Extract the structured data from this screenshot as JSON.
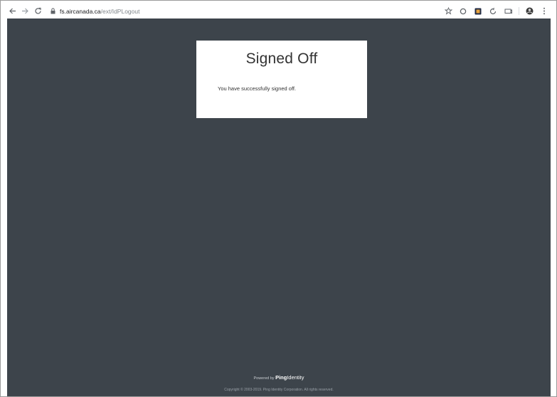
{
  "browser": {
    "url_host": "fs.aircanada.ca",
    "url_path": "/ext/IdPLogout"
  },
  "page": {
    "title": "Signed Off",
    "message": "You have successfully signed off.",
    "powered_by": "Powered by",
    "brand_ping": "Ping",
    "brand_identity": "Identity",
    "copyright": "Copyright © 2003-2019. Ping Identity Corporation. All rights reserved."
  },
  "colors": {
    "page_background": "#3d444b",
    "card_background": "#ffffff",
    "text": "#333333"
  },
  "icons": {
    "back": "arrow-left-icon",
    "forward": "arrow-right-icon",
    "reload": "reload-icon",
    "lock": "lock-icon",
    "bookmark": "star-icon",
    "extensions": [
      "circle-extension-icon",
      "square-extension-icon",
      "sync-extension-icon",
      "cast-extension-icon"
    ],
    "profile": "avatar-icon",
    "menu": "kebab-menu-icon"
  }
}
